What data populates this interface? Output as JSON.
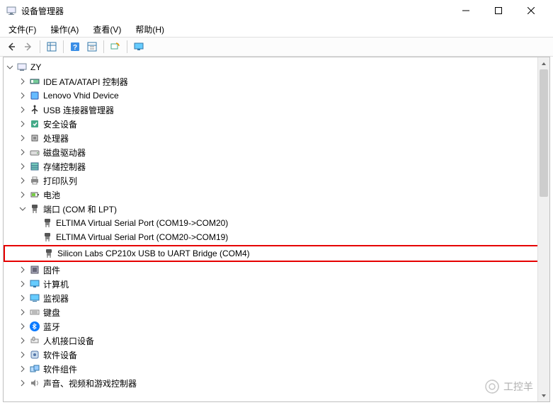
{
  "window": {
    "title": "设备管理器"
  },
  "menu": {
    "file": "文件(F)",
    "action": "操作(A)",
    "view": "查看(V)",
    "help": "帮助(H)"
  },
  "tree": {
    "root": "ZY",
    "items": [
      {
        "label": "IDE ATA/ATAPI 控制器",
        "icon": "ide"
      },
      {
        "label": "Lenovo Vhid Device",
        "icon": "device"
      },
      {
        "label": "USB 连接器管理器",
        "icon": "usb"
      },
      {
        "label": "安全设备",
        "icon": "security"
      },
      {
        "label": "处理器",
        "icon": "cpu"
      },
      {
        "label": "磁盘驱动器",
        "icon": "disk"
      },
      {
        "label": "存储控制器",
        "icon": "storage"
      },
      {
        "label": "打印队列",
        "icon": "printer"
      },
      {
        "label": "电池",
        "icon": "battery"
      }
    ],
    "ports": {
      "label": "端口 (COM 和 LPT)",
      "children": [
        "ELTIMA Virtual Serial Port (COM19->COM20)",
        "ELTIMA Virtual Serial Port (COM20->COM19)",
        "Silicon Labs CP210x USB to UART Bridge (COM4)"
      ]
    },
    "items2": [
      {
        "label": "固件",
        "icon": "firmware"
      },
      {
        "label": "计算机",
        "icon": "computer"
      },
      {
        "label": "监视器",
        "icon": "monitor"
      },
      {
        "label": "键盘",
        "icon": "keyboard"
      },
      {
        "label": "蓝牙",
        "icon": "bluetooth"
      },
      {
        "label": "人机接口设备",
        "icon": "hid"
      },
      {
        "label": "软件设备",
        "icon": "softdev"
      },
      {
        "label": "软件组件",
        "icon": "softcomp"
      },
      {
        "label": "声音、视频和游戏控制器",
        "icon": "audio"
      }
    ]
  },
  "watermark": "工控羊"
}
